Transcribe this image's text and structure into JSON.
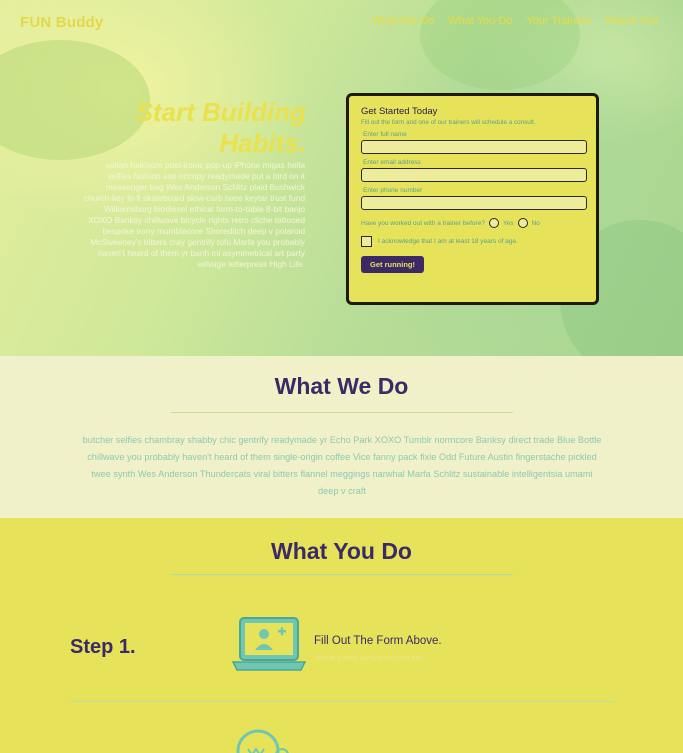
{
  "header": {
    "brand": "FUN Buddy",
    "nav": [
      "What We Do",
      "What You Do",
      "Your Trainers",
      "Reach Out"
    ]
  },
  "hero": {
    "title": "Start Building Habits.",
    "text": "seitan heirloom post-ironic pop-up iPhone migas hella selfies fashion axe occupy readymade put a bird on it messenger bag Wes Anderson Schlitz plaid Bushwick church-key lo-fi skateboard slow-carb twee keytar trust fund Williamsburg biodiesel ethical farm-to-table 8-bit banjo XOXO Banksy chillwave bicycle rights retro cliche tattooed bespoke irony mumblecore Shoreditch deep v polaroid McSweeney's bitters cray gentrify tofu Marfa you probably haven't heard of them yr banh mi asymmetrical art party selvage letterpress High Life."
  },
  "form": {
    "title": "Get Started Today",
    "subtitle": "Fill out the form and one of our trainers will schedule a consult.",
    "name_label": "Enter full name",
    "email_label": "Enter email address",
    "phone_label": "Enter phone number",
    "radio_question": "Have you worked out with a trainer before?",
    "radio_yes": "Yes",
    "radio_no": "No",
    "checkbox_label": "I acknowledge that I am at least 18 years of age.",
    "submit": "Get running!"
  },
  "what_we_do": {
    "title": "What We Do",
    "text": "butcher selfies chambray shabby chic gentrify readymade yr Echo Park XOXO Tumblr normcore Banksy direct trade Blue Bottle chillwave you probably haven't heard of them single-origin coffee Vice fanny pack fixie Odd Future Austin fingerstache pickled twee synth Wes Anderson Thundercats viral bitters flannel meggings narwhal Marfa Schlitz sustainable intelligentsia umami deep v craft"
  },
  "what_you_do": {
    "title": "What You Do",
    "step_label": "Step 1.",
    "step_title": "Fill Out The Form Above.",
    "step_sub": "You're a step away from success",
    "icon": "laptop-user-add-icon"
  },
  "colors": {
    "accent": "#3b2a66",
    "yellow": "#e6e25a",
    "teal": "#5aa390"
  }
}
